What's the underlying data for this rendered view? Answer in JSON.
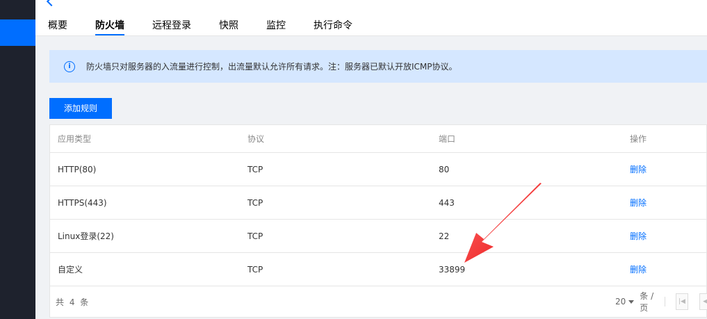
{
  "instance": {
    "name": "",
    "os": ""
  },
  "tabs": [
    {
      "label": "概要"
    },
    {
      "label": "防火墙"
    },
    {
      "label": "远程登录"
    },
    {
      "label": "快照"
    },
    {
      "label": "监控"
    },
    {
      "label": "执行命令"
    }
  ],
  "active_tab": "防火墙",
  "notice": {
    "text": "防火墙只对服务器的入流量进行控制，出流量默认允许所有请求。注：服务器已默认开放ICMP协议。",
    "icon": "info-icon"
  },
  "add_rule_button": "添加规则",
  "table": {
    "columns": [
      "应用类型",
      "协议",
      "端口",
      "操作"
    ],
    "rows": [
      {
        "app": "HTTP(80)",
        "protocol": "TCP",
        "port": "80",
        "action": "删除"
      },
      {
        "app": "HTTPS(443)",
        "protocol": "TCP",
        "port": "443",
        "action": "删除"
      },
      {
        "app": "Linux登录(22)",
        "protocol": "TCP",
        "port": "22",
        "action": "删除"
      },
      {
        "app": "自定义",
        "protocol": "TCP",
        "port": "33899",
        "action": "删除"
      }
    ]
  },
  "pagination": {
    "total_text": "共 4 条",
    "page_size": "20",
    "unit": "条 / 页"
  },
  "colors": {
    "accent": "#006eff",
    "sidebar": "#1e222d",
    "notice_bg": "#d5e7ff",
    "annotation_arrow": "#f02020"
  }
}
